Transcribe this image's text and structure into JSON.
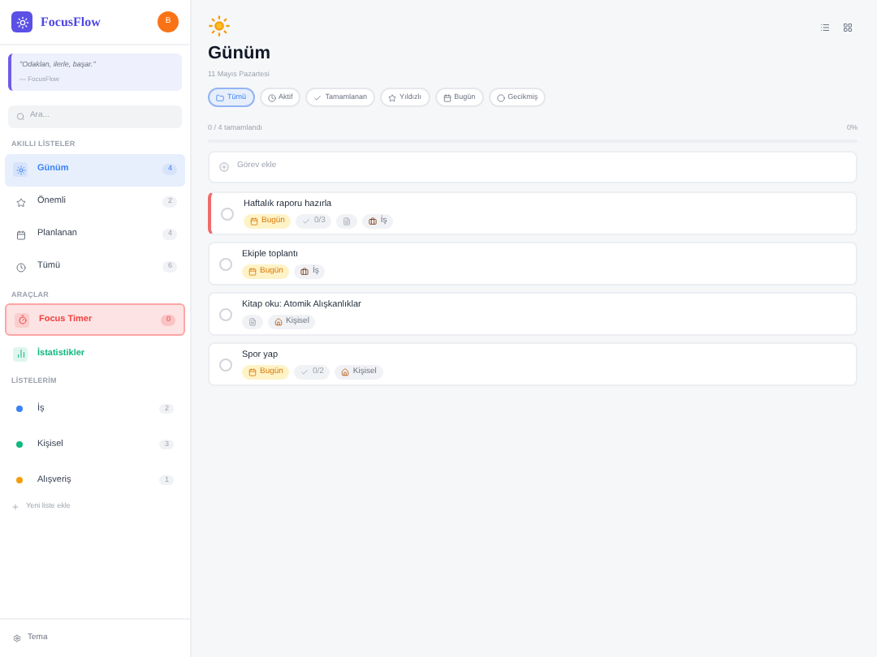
{
  "app": {
    "name": "FocusFlow",
    "avatar": "B"
  },
  "quote": {
    "text": "\"Odaklan, ilerle, başar.\"",
    "author": "— FocusFlow"
  },
  "search": {
    "placeholder": "Ara..."
  },
  "smart_lists": {
    "heading": "AKILLI LİSTELER",
    "items": [
      {
        "label": "Günüm",
        "count": "4",
        "selected": true
      },
      {
        "label": "Önemli",
        "count": "2",
        "selected": false
      },
      {
        "label": "Planlanan",
        "count": "4",
        "selected": false
      },
      {
        "label": "Tümü",
        "count": "6",
        "selected": false
      }
    ]
  },
  "tools": {
    "heading": "ARAÇLAR",
    "items": [
      {
        "label": "Focus Timer",
        "count": "0",
        "color": "#ef4444",
        "highlighted": true
      },
      {
        "label": "İstatistikler",
        "color": "#10b981",
        "highlighted": false
      }
    ]
  },
  "my_lists": {
    "heading": "LİSTELERİM",
    "items": [
      {
        "label": "İş",
        "count": "2",
        "color": "#3b82f6"
      },
      {
        "label": "Kişisel",
        "count": "3",
        "color": "#10b981"
      },
      {
        "label": "Alışveriş",
        "count": "1",
        "color": "#f59e0b"
      }
    ],
    "add_label": "Yeni liste ekle"
  },
  "theme_button": "Tema",
  "header": {
    "title": "Günüm",
    "date": "11 Mayıs Pazartesi"
  },
  "filters": [
    {
      "label": "Tümü",
      "selected": true
    },
    {
      "label": "Aktif",
      "selected": false
    },
    {
      "label": "Tamamlanan",
      "selected": false
    },
    {
      "label": "Yıldızlı",
      "selected": false
    },
    {
      "label": "Bugün",
      "selected": false
    },
    {
      "label": "Gecikmiş",
      "selected": false
    }
  ],
  "progress": {
    "label": "0 / 4 tamamlandı",
    "percent": "0%",
    "level": 0
  },
  "add_task": {
    "placeholder": "Görev ekle"
  },
  "tasks": [
    {
      "title": "Haftalık raporu hazırla",
      "done": false,
      "high_priority": true,
      "tags": [
        {
          "kind": "date",
          "text": "Bugün"
        },
        {
          "kind": "subtasks",
          "text": "0/3"
        },
        {
          "kind": "note"
        },
        {
          "kind": "work",
          "text": "İş"
        }
      ]
    },
    {
      "title": "Ekiple toplantı",
      "done": false,
      "high_priority": false,
      "tags": [
        {
          "kind": "date",
          "text": "Bugün"
        },
        {
          "kind": "work",
          "text": "İş"
        }
      ]
    },
    {
      "title": "Kitap oku: Atomik Alışkanlıklar",
      "done": false,
      "high_priority": false,
      "tags": [
        {
          "kind": "note"
        },
        {
          "kind": "home",
          "text": "Kişisel"
        }
      ]
    },
    {
      "title": "Spor yap",
      "done": false,
      "high_priority": false,
      "tags": [
        {
          "kind": "date",
          "text": "Bugün"
        },
        {
          "kind": "subtasks",
          "text": "0/2"
        },
        {
          "kind": "home",
          "text": "Kişisel"
        }
      ]
    }
  ]
}
